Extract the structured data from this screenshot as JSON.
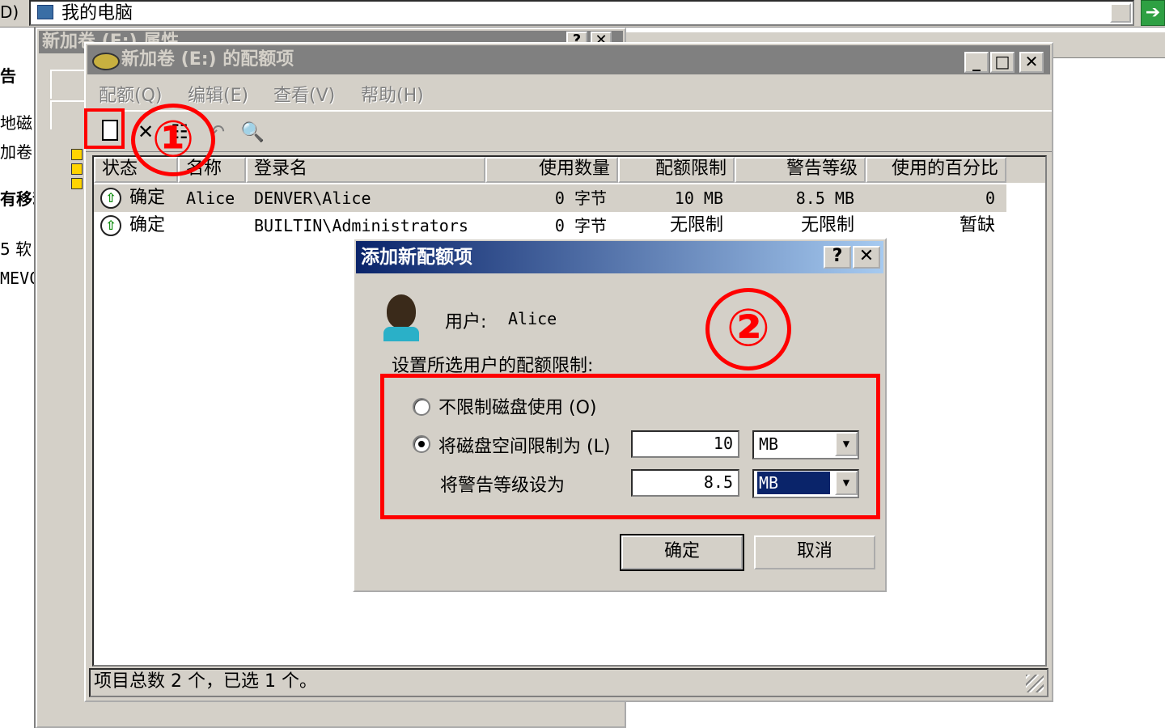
{
  "bg": {
    "drive_frag": "D)",
    "address": "我的电脑",
    "go_label": "➔",
    "left_frags": [
      "告",
      "地磁",
      "加卷",
      "有移动",
      "5 软",
      "MEVC"
    ]
  },
  "props": {
    "title": "新加卷 (E:) 属性",
    "help_btn": "?",
    "close_btn": "✕"
  },
  "quota": {
    "title": "新加卷 (E:) 的配额项",
    "min_btn": "_",
    "max_btn": "□",
    "close_btn": "✕",
    "menu": [
      "配额(Q)",
      "编辑(E)",
      "查看(V)",
      "帮助(H)"
    ],
    "toolbar": {
      "new_icon": "new-quota-entry-icon",
      "delete_icon": "✕",
      "properties_icon": "☷",
      "undo_icon": "↶",
      "find_icon": "🔍"
    },
    "callout1": "①",
    "columns": [
      "状态",
      "名称",
      "登录名",
      "使用数量",
      "配额限制",
      "警告等级",
      "使用的百分比"
    ],
    "rows": [
      {
        "status": "确定",
        "name": "Alice",
        "login": "DENVER\\Alice",
        "used": "0 字节",
        "limit": "10 MB",
        "warning": "8.5 MB",
        "percent": "0"
      },
      {
        "status": "确定",
        "name": "",
        "login": "BUILTIN\\Administrators",
        "used": "0 字节",
        "limit": "无限制",
        "warning": "无限制",
        "percent": "暂缺"
      }
    ],
    "status_bar": "项目总数 2 个，已选 1 个。"
  },
  "dialog": {
    "title": "添加新配额项",
    "help_btn": "?",
    "close_btn": "✕",
    "user_label": "用户:",
    "user_value": "Alice",
    "prompt": "设置所选用户的配额限制:",
    "callout2": "②",
    "opt_unlimited": "不限制磁盘使用 (O)",
    "opt_limit": "将磁盘空间限制为 (L)",
    "limit_value": "10",
    "limit_unit": "MB",
    "warn_label": "将警告等级设为",
    "warn_value": "8.5",
    "warn_unit": "MB",
    "ok": "确定",
    "cancel": "取消"
  },
  "colors": {
    "annotation": "#ff0000",
    "dialog_title_start": "#0a246a",
    "window_face": "#d4d0c8"
  }
}
